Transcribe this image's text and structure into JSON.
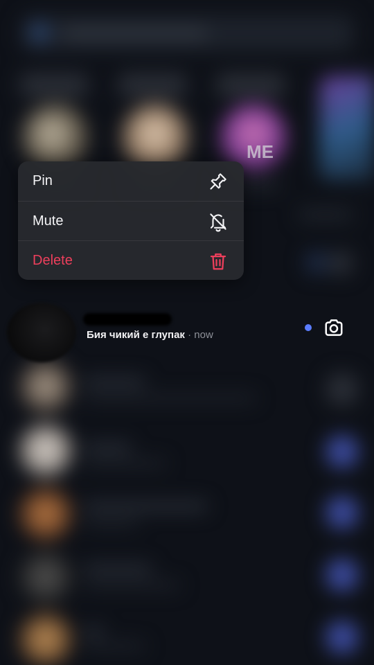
{
  "story_badge": {
    "text": "ME"
  },
  "context_menu": {
    "items": [
      {
        "label": "Pin",
        "icon": "pin-icon",
        "destructive": false
      },
      {
        "label": "Mute",
        "icon": "bell-off-icon",
        "destructive": false
      },
      {
        "label": "Delete",
        "icon": "trash-icon",
        "destructive": true
      }
    ]
  },
  "chat": {
    "preview": "Бия чикий е глупак",
    "separator": "·",
    "time": "now",
    "unread": true
  },
  "colors": {
    "background": "#0e1118",
    "menu_background": "#282a2e",
    "destructive": "#ee3f5c",
    "unread_dot": "#5b7dff"
  }
}
